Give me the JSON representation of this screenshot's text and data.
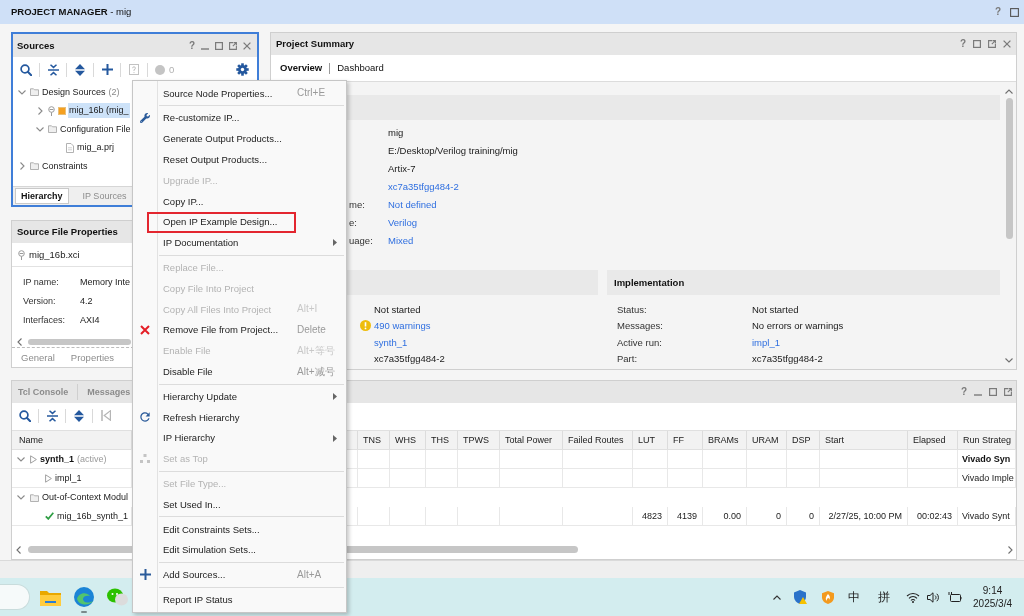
{
  "window": {
    "title": "**PROJECT MANAGER** - mig",
    "help": "?"
  },
  "sources": {
    "title": "Sources",
    "help": "?",
    "status_count": "0",
    "tree": [
      {
        "label": "Design Sources",
        "count": "(2)",
        "kind": "folder",
        "expanded": true,
        "selected": false,
        "children": [
          {
            "label": "mig_16b (mig_",
            "kind": "ip",
            "expanded": false,
            "selected": true
          },
          {
            "label": "Configuration File",
            "kind": "folder",
            "expanded": true,
            "selected": false,
            "children": [
              {
                "label": "mig_a.prj",
                "kind": "file",
                "selected": false
              }
            ]
          }
        ]
      },
      {
        "label": "Constraints",
        "kind": "folder",
        "expanded": false,
        "selected": false
      }
    ],
    "tabs": [
      {
        "label": "Hierarchy",
        "selected": true
      },
      {
        "label": "IP Sources",
        "selected": false
      }
    ]
  },
  "source_file_properties": {
    "title": "Source File Properties",
    "file": "mig_16b.xci",
    "properties": [
      {
        "label": "IP name:",
        "value": "Memory Inte"
      },
      {
        "label": "Version:",
        "value": "4.2"
      },
      {
        "label": "Interfaces:",
        "value": "AXI4"
      }
    ],
    "tabs": [
      {
        "label": "General",
        "selected": false
      },
      {
        "label": "Properties",
        "selected": false
      }
    ]
  },
  "project_summary": {
    "title": "Project Summary",
    "help": "?",
    "tabs": [
      {
        "label": "Overview",
        "selected": true
      },
      {
        "label": "Dashboard",
        "selected": false
      }
    ],
    "settings": [
      {
        "value": "mig",
        "link": false
      },
      {
        "value": "E:/Desktop/Verilog training/mig",
        "link": false
      },
      {
        "value": "Artix-7",
        "link": false
      },
      {
        "value": "xc7a35tfgg484-2",
        "link": true
      },
      {
        "label": "me:",
        "value": "Not defined",
        "link": true
      },
      {
        "label": "e:",
        "value": "Verilog",
        "link": true
      },
      {
        "label": "uage:",
        "value": "Mixed",
        "link": true
      }
    ],
    "synthesis": [
      {
        "kind": "plain",
        "value": "Not started",
        "link": false
      },
      {
        "kind": "warning",
        "value": "490 warnings",
        "link": true
      },
      {
        "kind": "plain",
        "value": "synth_1",
        "link": true
      },
      {
        "kind": "plain",
        "value": "xc7a35tfgg484-2",
        "link": false
      }
    ],
    "implementation": {
      "title": "Implementation",
      "rows": [
        {
          "label": "Status:",
          "value": "Not started",
          "link": false
        },
        {
          "label": "Messages:",
          "value": "No errors or warnings",
          "link": false
        },
        {
          "label": "Active run:",
          "value": "impl_1",
          "link": true
        },
        {
          "label": "Part:",
          "value": "xc7a35tfgg484-2",
          "link": false
        }
      ]
    }
  },
  "console": {
    "help": "?",
    "tabs": [
      {
        "label": "Tcl Console",
        "selected": false
      },
      {
        "label": "Messages",
        "selected": false
      }
    ],
    "table": {
      "name_header": "Name",
      "columns": [
        {
          "label": "TNS",
          "kind": "number"
        },
        {
          "label": "WHS",
          "kind": "number"
        },
        {
          "label": "THS",
          "kind": "number"
        },
        {
          "label": "TPWS",
          "kind": "number"
        },
        {
          "label": "Total Power",
          "kind": "number"
        },
        {
          "label": "Failed Routes",
          "kind": "number"
        },
        {
          "label": "LUT",
          "kind": "number"
        },
        {
          "label": "FF",
          "kind": "number"
        },
        {
          "label": "BRAMs",
          "kind": "number"
        },
        {
          "label": "URAM",
          "kind": "number"
        },
        {
          "label": "DSP",
          "kind": "number"
        },
        {
          "label": "Start",
          "kind": "number"
        },
        {
          "label": "Elapsed",
          "kind": "number"
        },
        {
          "label": "Run Strateg",
          "kind": "text"
        }
      ],
      "rows": [
        {
          "kind": "run",
          "name": "synth_1",
          "note": "(active)",
          "active": true,
          "expanded": true,
          "cells": [
            null,
            null,
            null,
            null,
            null,
            null,
            null,
            null,
            null,
            null,
            null,
            null,
            null,
            "Vivado Syn"
          ],
          "children": [
            {
              "kind": "run",
              "name": "impl_1",
              "active": false,
              "cells": [
                null,
                null,
                null,
                null,
                null,
                null,
                null,
                null,
                null,
                null,
                null,
                null,
                null,
                "Vivado Imple"
              ]
            }
          ]
        },
        {
          "kind": "group",
          "name": "Out-of-Context Modul",
          "active": false,
          "expanded": true,
          "children": [
            {
              "kind": "done",
              "name": "mig_16b_synth_1",
              "active": false,
              "cells": [
                null,
                null,
                null,
                null,
                null,
                null,
                "4823",
                "4139",
                "0.00",
                "0",
                "0",
                "2/27/25, 10:00 PM",
                "00:02:43",
                "Vivado Synt"
              ]
            }
          ]
        }
      ]
    }
  },
  "context_menu": {
    "groups": [
      {
        "items": [
          {
            "label": "Source Node Properties...",
            "shortcut": "Ctrl+E",
            "kind": "text",
            "disabled": false,
            "submenu": false,
            "marked": false
          }
        ]
      },
      {
        "items": [
          {
            "label": "Re-customize IP...",
            "kind": "tool",
            "disabled": false,
            "submenu": false,
            "marked": false
          },
          {
            "label": "Generate Output Products...",
            "kind": "text",
            "disabled": false,
            "submenu": false,
            "marked": false
          },
          {
            "label": "Reset Output Products...",
            "kind": "text",
            "disabled": false,
            "submenu": false,
            "marked": false
          },
          {
            "label": "Upgrade IP...",
            "kind": "text",
            "disabled": true,
            "submenu": false,
            "marked": false
          },
          {
            "label": "Copy IP...",
            "kind": "text",
            "disabled": false,
            "submenu": false,
            "marked": false
          },
          {
            "label": "Open IP Example Design...",
            "kind": "text",
            "disabled": false,
            "submenu": false,
            "marked": true
          },
          {
            "label": "IP Documentation",
            "kind": "text",
            "disabled": false,
            "submenu": true,
            "marked": false
          }
        ]
      },
      {
        "items": [
          {
            "label": "Replace File...",
            "kind": "text",
            "disabled": true,
            "submenu": false,
            "marked": false
          },
          {
            "label": "Copy File Into Project",
            "kind": "text",
            "disabled": true,
            "submenu": false,
            "marked": false
          },
          {
            "label": "Copy All Files Into Project",
            "shortcut": "Alt+I",
            "kind": "text",
            "disabled": true,
            "submenu": false,
            "marked": false
          },
          {
            "label": "Remove File from Project...",
            "shortcut": "Delete",
            "kind": "delete",
            "disabled": false,
            "submenu": false,
            "marked": false
          },
          {
            "label": "Enable File",
            "shortcut": "Alt+等号",
            "kind": "text",
            "disabled": true,
            "submenu": false,
            "marked": false
          },
          {
            "label": "Disable File",
            "shortcut": "Alt+减号",
            "kind": "text",
            "disabled": false,
            "submenu": false,
            "marked": false
          }
        ]
      },
      {
        "items": [
          {
            "label": "Hierarchy Update",
            "kind": "text",
            "disabled": false,
            "submenu": true,
            "marked": false
          },
          {
            "label": "Refresh Hierarchy",
            "kind": "refresh",
            "disabled": false,
            "submenu": false,
            "marked": false
          },
          {
            "label": "IP Hierarchy",
            "kind": "text",
            "disabled": false,
            "submenu": true,
            "marked": false
          },
          {
            "label": "Set as Top",
            "kind": "tree",
            "disabled": true,
            "submenu": false,
            "marked": false
          }
        ]
      },
      {
        "items": [
          {
            "label": "Set File Type...",
            "kind": "text",
            "disabled": true,
            "submenu": false,
            "marked": false
          },
          {
            "label": "Set Used In...",
            "kind": "text",
            "disabled": false,
            "submenu": false,
            "marked": false
          }
        ]
      },
      {
        "items": [
          {
            "label": "Edit Constraints Sets...",
            "kind": "text",
            "disabled": false,
            "submenu": false,
            "marked": false
          },
          {
            "label": "Edit Simulation Sets...",
            "kind": "text",
            "disabled": false,
            "submenu": false,
            "marked": false
          }
        ]
      },
      {
        "items": [
          {
            "label": "Add Sources...",
            "shortcut": "Alt+A",
            "kind": "add",
            "disabled": false,
            "submenu": false,
            "marked": false
          }
        ]
      },
      {
        "items": [
          {
            "label": "Report IP Status",
            "kind": "text",
            "disabled": false,
            "submenu": false,
            "marked": false
          }
        ]
      }
    ]
  },
  "taskbar": {
    "input_modes": [
      "中",
      "拼"
    ],
    "time": "9:14",
    "date": "2025/3/4"
  }
}
